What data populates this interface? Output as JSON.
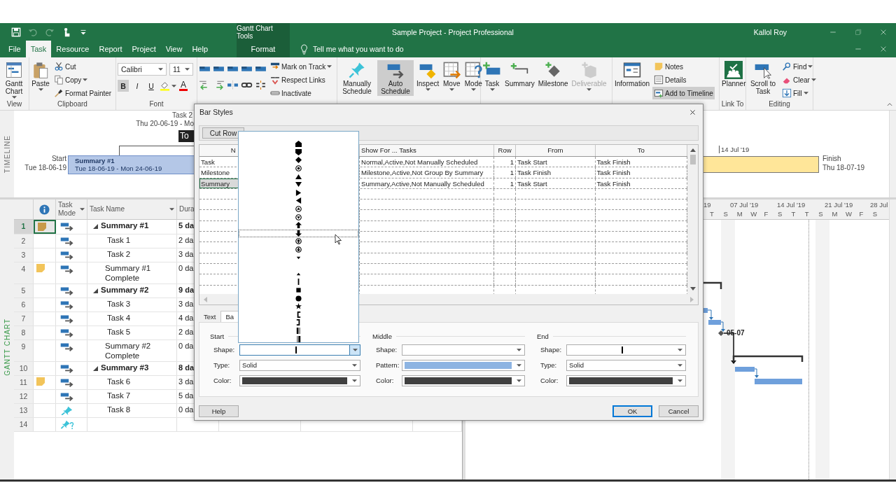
{
  "title_bar": {
    "context_tab_group": "Gantt Chart Tools",
    "title": "Sample Project  -  Project Professional",
    "user": "Kallol Roy"
  },
  "ribbon_tabs": [
    {
      "label": "File",
      "selected": false,
      "contextual": false
    },
    {
      "label": "Task",
      "selected": true,
      "contextual": false
    },
    {
      "label": "Resource",
      "selected": false,
      "contextual": false
    },
    {
      "label": "Report",
      "selected": false,
      "contextual": false
    },
    {
      "label": "Project",
      "selected": false,
      "contextual": false
    },
    {
      "label": "View",
      "selected": false,
      "contextual": false
    },
    {
      "label": "Help",
      "selected": false,
      "contextual": false
    },
    {
      "label": "Format",
      "selected": false,
      "contextual": true
    }
  ],
  "tell_me": {
    "placeholder": "Tell me what you want to do"
  },
  "ribbon_groups": [
    {
      "kind": "buttons",
      "label": "View",
      "commands": [
        {
          "kind": "large",
          "label": "Gantt Chart",
          "menu": true,
          "selected": false,
          "disabled": false
        }
      ]
    },
    {
      "kind": "buttons",
      "label": "Clipboard",
      "commands": [
        {
          "kind": "large",
          "label": "Paste",
          "menu": true,
          "selected": false,
          "disabled": false
        },
        {
          "kind": "small",
          "label": "Cut",
          "menu": false,
          "selected": false,
          "disabled": false
        },
        {
          "kind": "small",
          "label": "Copy",
          "menu": true,
          "selected": false,
          "disabled": false
        },
        {
          "kind": "small",
          "label": "Format Painter",
          "menu": false,
          "selected": false,
          "disabled": false
        }
      ]
    },
    {
      "kind": "font",
      "label": "Font",
      "font": "Calibri",
      "size": "11",
      "styles": [
        {
          "label": "B",
          "selected": true
        },
        {
          "label": "I",
          "selected": false
        },
        {
          "label": "U",
          "selected": false
        }
      ],
      "font_color": "A"
    },
    {
      "kind": "schedule",
      "commands": [
        {
          "kind": "small",
          "label": "Mark on Track",
          "menu": true,
          "selected": false,
          "disabled": false
        },
        {
          "kind": "small",
          "label": "Respect Links",
          "menu": false,
          "selected": false,
          "disabled": false
        },
        {
          "kind": "small",
          "label": "Inactivate",
          "menu": false,
          "selected": false,
          "disabled": false
        }
      ]
    },
    {
      "kind": "buttons",
      "commands": [
        {
          "kind": "large",
          "label": "Manually Schedule",
          "menu": false,
          "selected": false,
          "disabled": false
        },
        {
          "kind": "large",
          "label": "Auto Schedule",
          "menu": false,
          "selected": true,
          "disabled": false
        },
        {
          "kind": "large",
          "label": "Inspect",
          "menu": true,
          "selected": false,
          "disabled": false
        },
        {
          "kind": "large",
          "label": "Move",
          "menu": true,
          "selected": false,
          "disabled": false
        },
        {
          "kind": "large",
          "label": "Mode",
          "menu": true,
          "selected": false,
          "disabled": false
        }
      ]
    },
    {
      "kind": "buttons",
      "commands": [
        {
          "kind": "large",
          "label": "Task",
          "menu": true,
          "selected": false,
          "disabled": false
        },
        {
          "kind": "large",
          "label": "Summary",
          "menu": false,
          "selected": false,
          "disabled": false
        },
        {
          "kind": "large",
          "label": "Milestone",
          "menu": false,
          "selected": false,
          "disabled": false
        },
        {
          "kind": "large",
          "label": "Deliverable",
          "menu": true,
          "selected": false,
          "disabled": true
        }
      ]
    },
    {
      "kind": "buttons",
      "commands": [
        {
          "kind": "large",
          "label": "Information",
          "menu": false,
          "selected": false,
          "disabled": false
        },
        {
          "kind": "small",
          "label": "Notes",
          "menu": false,
          "selected": false,
          "disabled": false
        },
        {
          "kind": "small",
          "label": "Details",
          "menu": false,
          "selected": false,
          "disabled": false
        },
        {
          "kind": "small",
          "label": "Add to Timeline",
          "menu": false,
          "selected": true,
          "disabled": false
        }
      ]
    },
    {
      "kind": "buttons",
      "label": "Link To",
      "commands": [
        {
          "kind": "large",
          "label": "Planner",
          "menu": false,
          "selected": false,
          "disabled": false
        }
      ]
    },
    {
      "kind": "buttons",
      "label": "Editing",
      "commands": [
        {
          "kind": "large",
          "label": "Scroll to Task",
          "menu": false,
          "selected": false,
          "disabled": false
        },
        {
          "kind": "small",
          "label": "Find",
          "menu": true,
          "selected": false,
          "disabled": false
        },
        {
          "kind": "small",
          "label": "Clear",
          "menu": true,
          "selected": false,
          "disabled": false
        },
        {
          "kind": "small",
          "label": "Fill",
          "menu": true,
          "selected": false,
          "disabled": false
        }
      ]
    }
  ],
  "timeline": {
    "label": "TIMELINE",
    "callout": {
      "name": "Task 2",
      "dates": "Thu 20-06-19 - Mo"
    },
    "tag": "To",
    "start": {
      "label": "Start",
      "date": "Tue 18-06-19"
    },
    "bar": {
      "name": "Summary #1",
      "dates": "Tue 18-06-19 - Mon 24-06-19"
    },
    "scale_label": "14 Jul '19",
    "finish": {
      "label": "Finish",
      "date": "Thu 18-07-19"
    }
  },
  "task_table": {
    "columns": [
      {
        "label": "Task Mode",
        "menu": true
      },
      {
        "label": "Task Name",
        "menu": true
      },
      {
        "label": "Dura",
        "menu": false
      }
    ],
    "rows": [
      {
        "id": "1",
        "name": "Summary #1",
        "duration": "5 da",
        "kind": "summary",
        "expanded": true,
        "selected": true,
        "note": true,
        "manual": false
      },
      {
        "id": "2",
        "name": "Task 1",
        "duration": "2 da",
        "kind": "task",
        "expanded": false,
        "selected": false,
        "note": false,
        "manual": false
      },
      {
        "id": "3",
        "name": "Task 2",
        "duration": "3 da",
        "kind": "task",
        "expanded": false,
        "selected": false,
        "note": false,
        "manual": false
      },
      {
        "id": "4",
        "name": "Summary #1 Complete",
        "duration": "0 da",
        "kind": "milestone",
        "expanded": false,
        "selected": false,
        "note": true,
        "manual": false
      },
      {
        "id": "5",
        "name": "Summary #2",
        "duration": "9 da",
        "kind": "summary",
        "expanded": true,
        "selected": false,
        "note": false,
        "manual": false
      },
      {
        "id": "6",
        "name": "Task 3",
        "duration": "3 da",
        "kind": "task",
        "expanded": false,
        "selected": false,
        "note": false,
        "manual": false
      },
      {
        "id": "7",
        "name": "Task 4",
        "duration": "4 da",
        "kind": "task",
        "expanded": false,
        "selected": false,
        "note": false,
        "manual": false
      },
      {
        "id": "8",
        "name": "Task 5",
        "duration": "2 da",
        "kind": "task",
        "expanded": false,
        "selected": false,
        "note": false,
        "manual": false
      },
      {
        "id": "9",
        "name": "Summary #2 Complete",
        "duration": "0 da",
        "kind": "milestone",
        "expanded": false,
        "selected": false,
        "note": false,
        "manual": false
      },
      {
        "id": "10",
        "name": "Summary #3",
        "duration": "8 da",
        "kind": "summary",
        "expanded": true,
        "selected": false,
        "note": false,
        "manual": false
      },
      {
        "id": "11",
        "name": "Task 6",
        "duration": "3 da",
        "kind": "task",
        "expanded": false,
        "selected": false,
        "note": true,
        "manual": false
      },
      {
        "id": "12",
        "name": "Task 7",
        "duration": "5 da",
        "kind": "task",
        "expanded": false,
        "selected": false,
        "note": false,
        "manual": false
      },
      {
        "id": "13",
        "name": "Task 8",
        "duration": "0 da",
        "kind": "task",
        "expanded": false,
        "selected": false,
        "note": false,
        "manual": true
      },
      {
        "id": "14",
        "kind": "blank",
        "expanded": false,
        "selected": false,
        "note": false,
        "manual": true
      }
    ]
  },
  "gantt": {
    "label": "GANTT CHART",
    "timescale_major": [
      "19",
      "07 Jul '19",
      "14 Jul '19",
      "21 Jul '19",
      "28 Jul"
    ],
    "timescale_minor": [
      "T",
      "S",
      "M",
      "W",
      "F",
      "S",
      "T",
      "T",
      "S",
      "M",
      "W",
      "F",
      "S"
    ],
    "milestone_label": "05-07"
  },
  "dialog": {
    "title": "Bar Styles",
    "toolbar": [
      "Cut Row"
    ],
    "columns": [
      "N",
      "Show For ... Tasks",
      "Row",
      "From",
      "To"
    ],
    "rows": [
      {
        "cells": [
          "Task",
          "Normal,Active,Not Manually Scheduled",
          "1",
          "Task Start",
          "Task Finish"
        ],
        "selected": false
      },
      {
        "cells": [
          "Milestone",
          "Milestone,Active,Not Group By Summary",
          "1",
          "Task Finish",
          "Task Finish"
        ],
        "selected": false
      },
      {
        "cells": [
          "Summary",
          "Summary,Active,Not Manually Scheduled",
          "1",
          "Task Start",
          "Task Finish"
        ],
        "selected": true
      }
    ],
    "tabs": [
      {
        "label": "Text",
        "selected": false
      },
      {
        "label": "Ba",
        "selected": true
      }
    ],
    "sections": [
      {
        "title": "Start",
        "fields": [
          {
            "label": "Shape:",
            "kind": "shape",
            "value_shape": {
              "kind": "bar"
            },
            "open": true
          },
          {
            "label": "Type:",
            "kind": "text",
            "value": "Solid",
            "open": false
          },
          {
            "label": "Color:",
            "kind": "color",
            "color": "#404040",
            "open": false
          }
        ]
      },
      {
        "title": "Middle",
        "fields": [
          {
            "label": "Shape:",
            "kind": "shape",
            "open": false
          },
          {
            "label": "Pattern:",
            "kind": "pattern",
            "color": "#8db4e2",
            "open": false
          },
          {
            "label": "Color:",
            "kind": "color",
            "color": "#404040",
            "open": false
          }
        ]
      },
      {
        "title": "End",
        "fields": [
          {
            "label": "Shape:",
            "kind": "shape",
            "value_shape": {
              "kind": "bar"
            },
            "open": false
          },
          {
            "label": "Type:",
            "kind": "text",
            "value": "Solid",
            "open": false
          },
          {
            "label": "Color:",
            "kind": "color",
            "color": "#404040",
            "open": false
          }
        ]
      }
    ],
    "shape_list": [
      {
        "kind": "house-up",
        "selected": false
      },
      {
        "kind": "house-down",
        "selected": false
      },
      {
        "kind": "diamond",
        "selected": false
      },
      {
        "kind": "circle-dot",
        "selected": false
      },
      {
        "kind": "triangle-up",
        "selected": false
      },
      {
        "kind": "triangle-down",
        "selected": false
      },
      {
        "kind": "triangle-right",
        "selected": false
      },
      {
        "kind": "triangle-left",
        "selected": false
      },
      {
        "kind": "circle-triangle-up",
        "selected": false
      },
      {
        "kind": "circle-triangle-down",
        "selected": false
      },
      {
        "kind": "arrow-up",
        "selected": false
      },
      {
        "kind": "arrow-down",
        "selected": true
      },
      {
        "kind": "circle-arrow-up",
        "selected": false
      },
      {
        "kind": "circle-arrow-down",
        "selected": false
      },
      {
        "kind": "small-down",
        "selected": false
      },
      {
        "kind": "none",
        "selected": false
      },
      {
        "kind": "small-up",
        "selected": false
      },
      {
        "kind": "bar",
        "selected": false
      },
      {
        "kind": "square",
        "selected": false
      },
      {
        "kind": "circle",
        "selected": false
      },
      {
        "kind": "star",
        "selected": false
      },
      {
        "kind": "bracket-left",
        "selected": false
      },
      {
        "kind": "bracket-right",
        "selected": false
      },
      {
        "kind": "gradient-left",
        "selected": false
      },
      {
        "kind": "gradient-right",
        "selected": false
      }
    ],
    "buttons": [
      {
        "label": "Help",
        "kind": "plain"
      },
      {
        "label": "OK",
        "kind": "default"
      },
      {
        "label": "Cancel",
        "kind": "plain"
      }
    ]
  }
}
